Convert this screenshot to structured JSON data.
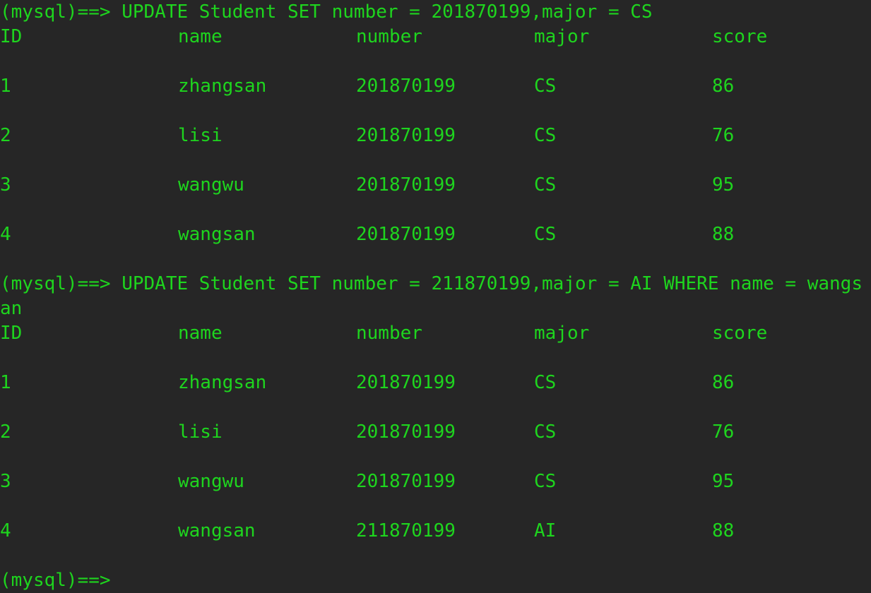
{
  "colors": {
    "background": "#262626",
    "text": "#1ed51e"
  },
  "commands": [
    {
      "prompt": "(mysql)==>",
      "text_line1": " UPDATE Student SET number = 201870199,major = CS",
      "text_line2": ""
    },
    {
      "prompt": "(mysql)==>",
      "text_line1": " UPDATE Student SET number = 211870199,major = AI WHERE name = wangs",
      "text_line2": "an"
    }
  ],
  "tables": [
    {
      "headers": [
        "ID",
        "name",
        "number",
        "major",
        "score"
      ],
      "rows": [
        [
          "1",
          "zhangsan",
          "201870199",
          "CS",
          "86"
        ],
        [
          "2",
          "lisi",
          "201870199",
          "CS",
          "76"
        ],
        [
          "3",
          "wangwu",
          "201870199",
          "CS",
          "95"
        ],
        [
          "4",
          "wangsan",
          "201870199",
          "CS",
          "88"
        ]
      ]
    },
    {
      "headers": [
        "ID",
        "name",
        "number",
        "major",
        "score"
      ],
      "rows": [
        [
          "1",
          "zhangsan",
          "201870199",
          "CS",
          "86"
        ],
        [
          "2",
          "lisi",
          "201870199",
          "CS",
          "76"
        ],
        [
          "3",
          "wangwu",
          "201870199",
          "CS",
          "95"
        ],
        [
          "4",
          "wangsan",
          "211870199",
          "AI",
          "88"
        ]
      ]
    }
  ],
  "final_prompt": "(mysql)==>"
}
